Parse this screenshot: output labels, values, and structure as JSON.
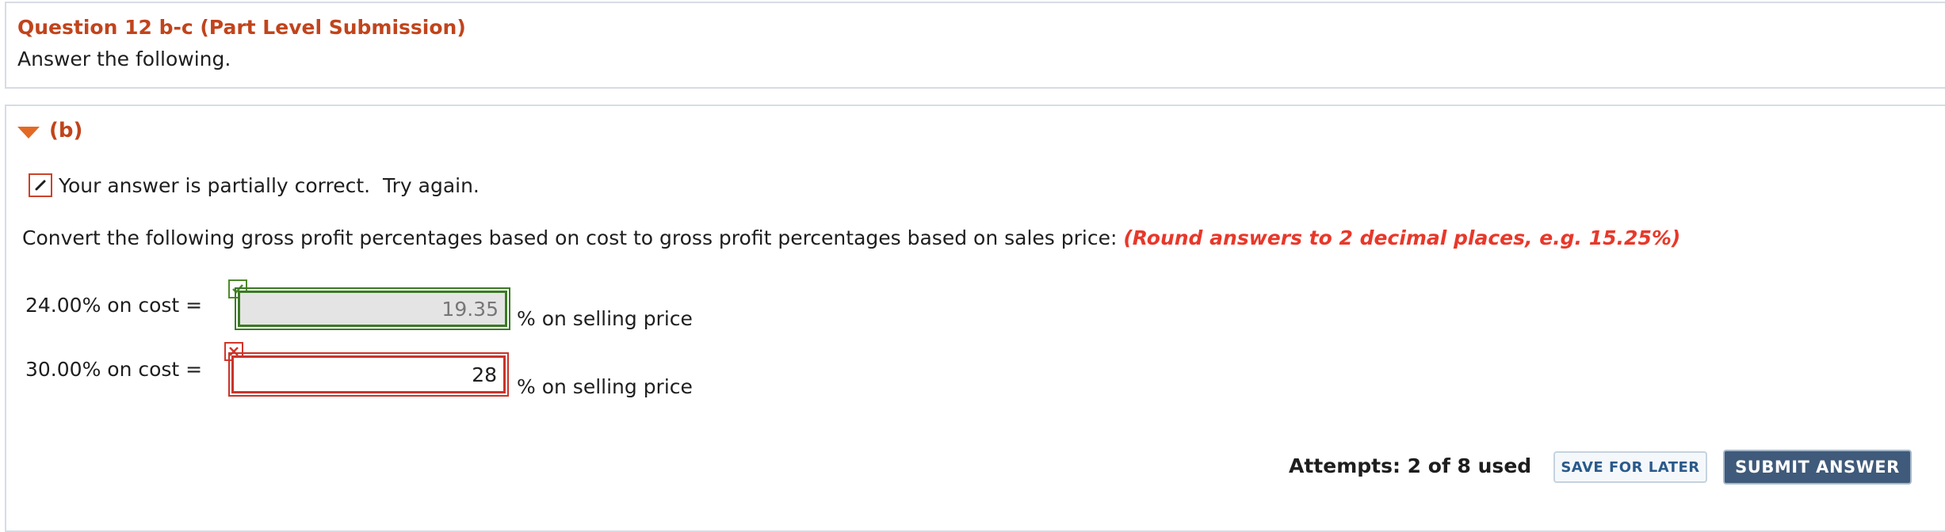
{
  "question": {
    "title": "Question 12 b-c (Part Level Submission)",
    "instruction": "Answer the following."
  },
  "part": {
    "label": "(b)",
    "toggle_icon": "caret-down-icon"
  },
  "feedback": {
    "icon": "pencil-icon",
    "text": "Your answer is partially correct.  Try again."
  },
  "prompt": {
    "text": "Convert the following gross profit percentages based on cost to gross profit percentages based on sales price: ",
    "hint": "(Round answers to 2 decimal places, e.g. 15.25%)"
  },
  "rows": [
    {
      "label": "24.00% on cost =",
      "value": "19.35",
      "suffix": "% on selling price",
      "status": "correct",
      "status_icon": "check-icon"
    },
    {
      "label": "30.00% on cost =",
      "value": "28",
      "suffix": "% on selling price",
      "status": "incorrect",
      "status_icon": "x-icon"
    }
  ],
  "footer": {
    "attempts": "Attempts: 2 of 8 used",
    "save_label": "SAVE FOR LATER",
    "submit_label": "SUBMIT ANSWER"
  },
  "colors": {
    "title_accent": "#c1441c",
    "hint_red": "#e8382a",
    "correct_green": "#3b7a25",
    "incorrect_red": "#c9342a",
    "submit_bg": "#3f5a7a"
  }
}
